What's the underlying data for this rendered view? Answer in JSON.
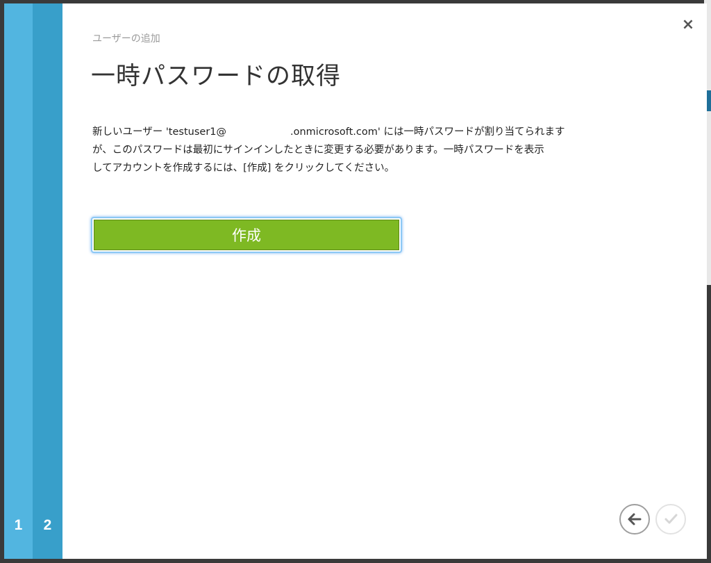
{
  "wizard": {
    "steps": [
      "1",
      "2"
    ],
    "subtitle": "ユーザーの追加",
    "title": "一時パスワードの取得",
    "description": {
      "line1_before": "新しいユーザー 'testuser1@",
      "line1_after": ".onmicrosoft.com' には一時パスワードが割り当てられます",
      "line2": "が、このパスワードは最初にサインインしたときに変更する必要があります。一時パスワードを表示",
      "line3": "してアカウントを作成するには、[作成] をクリックしてください。"
    },
    "create_label": "作成",
    "close_glyph": "×"
  },
  "colors": {
    "step1": "#52b5e0",
    "step2": "#389fca",
    "button": "#7eb923"
  },
  "icons": {
    "close": "close-icon",
    "back": "arrow-left-icon",
    "finish": "checkmark-icon"
  }
}
